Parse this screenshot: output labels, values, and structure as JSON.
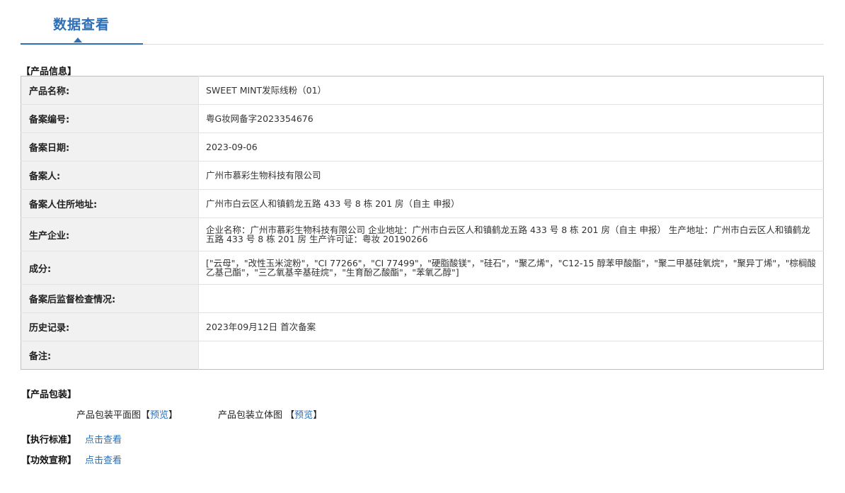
{
  "header": {
    "tab_title": "数据查看"
  },
  "product_info": {
    "section_title": "【产品信息】",
    "rows": [
      {
        "key": "产品名称:",
        "value": "SWEET MINT发际线粉（01）"
      },
      {
        "key": "备案编号:",
        "value": "粤G妆网备字2023354676"
      },
      {
        "key": "备案日期:",
        "value": "2023-09-06"
      },
      {
        "key": "备案人:",
        "value": "广州市慕彩生物科技有限公司"
      },
      {
        "key": "备案人住所地址:",
        "value": "广州市白云区人和镇鹤龙五路 433 号 8 栋 201 房（自主 申报）"
      },
      {
        "key": "生产企业:",
        "value": "企业名称：广州市慕彩生物科技有限公司 企业地址：广州市白云区人和镇鹤龙五路 433 号 8 栋 201 房（自主 申报） 生产地址：广州市白云区人和镇鹤龙五路 433 号 8 栋 201 房 生产许可证：粤妆 20190266"
      },
      {
        "key": "成分:",
        "value": "[\"云母\"，\"改性玉米淀粉\"，\"CI 77266\"，\"CI 77499\"，\"硬脂酸镁\"，\"硅石\"，\"聚乙烯\"，\"C12-15 醇苯甲酸酯\"，\"聚二甲基硅氧烷\"，\"聚异丁烯\"，\"棕榈酸乙基己酯\"，\"三乙氧基辛基硅烷\"，\"生育酚乙酸酯\"，\"苯氧乙醇\"]"
      },
      {
        "key": "备案后监督检查情况:",
        "value": ""
      },
      {
        "key": "历史记录:",
        "value": "2023年09月12日 首次备案"
      },
      {
        "key": "备注:",
        "value": ""
      }
    ]
  },
  "packaging": {
    "section_title": "【产品包装】",
    "flat_label": "产品包装平面图",
    "flat_link": "预览",
    "stereo_label": "产品包装立体图",
    "stereo_link": "预览",
    "bracket_open": "【",
    "bracket_close": "】"
  },
  "standard": {
    "label": "【执行标准】",
    "link": "点击查看"
  },
  "efficacy": {
    "label": "【功效宣称】",
    "link": "点击查看"
  }
}
